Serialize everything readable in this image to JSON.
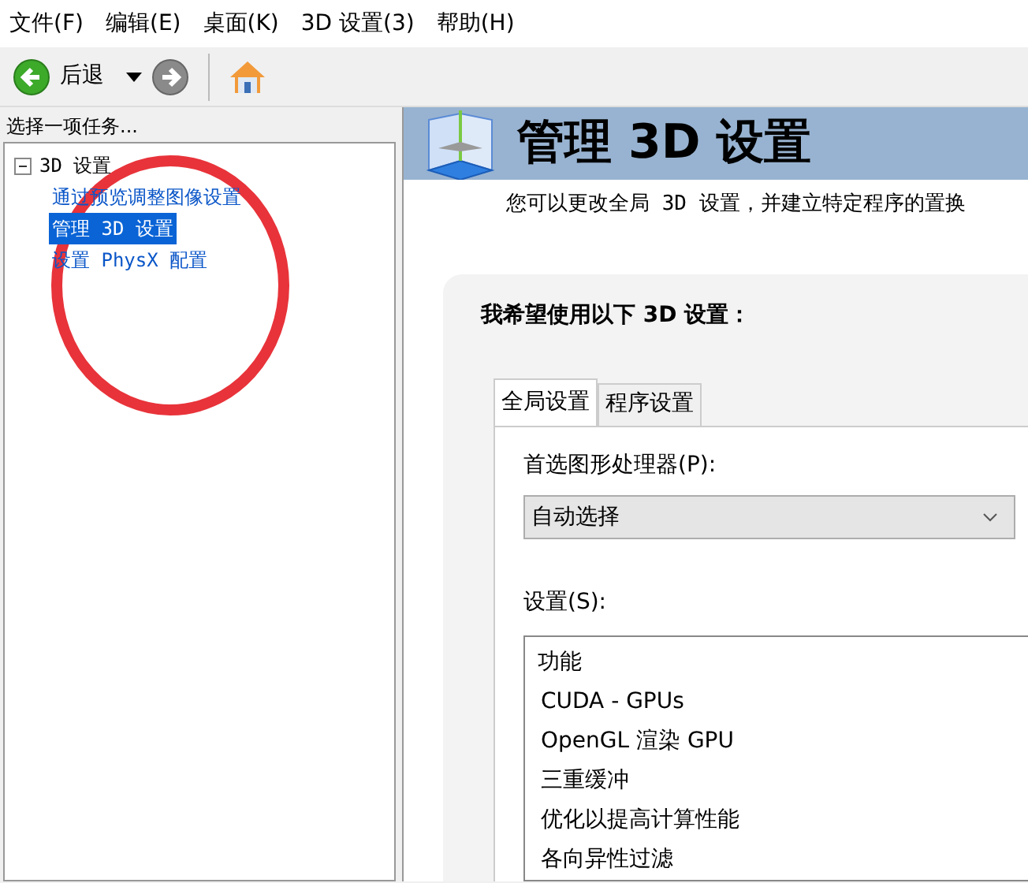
{
  "menu": [
    "文件(F)",
    "编辑(E)",
    "桌面(K)",
    "3D 设置(3)",
    "帮助(H)"
  ],
  "toolbar": {
    "back_label": "后退"
  },
  "sidebar": {
    "caption": "选择一项任务...",
    "tree": [
      {
        "label": "3D 设置",
        "expanded": true,
        "selected": false,
        "children": [
          {
            "label": "通过预览调整图像设置",
            "selected": false
          },
          {
            "label": "管理 3D 设置",
            "selected": true
          },
          {
            "label": "设置 PhysX 配置",
            "selected": false
          }
        ]
      }
    ]
  },
  "header": {
    "title": "管理 3D 设置"
  },
  "description": "您可以更改全局 3D 设置，并建立特定程序的置换",
  "panel": {
    "heading": "我希望使用以下 3D 设置：",
    "tabs": [
      {
        "label": "全局设置",
        "selected": true
      },
      {
        "label": "程序设置",
        "selected": false
      }
    ],
    "gpu_label": "首选图形处理器(P):",
    "gpu_value": "自动选择",
    "settings_label": "设置(S):",
    "settings": [
      {
        "label": "功能",
        "kind": "header"
      },
      {
        "label": "CUDA - GPUs",
        "kind": "row"
      },
      {
        "label": "OpenGL 渲染 GPU",
        "kind": "row"
      },
      {
        "label": "三重缓冲",
        "kind": "row"
      },
      {
        "label": "优化以提高计算性能",
        "kind": "row"
      },
      {
        "label": "各向异性过滤",
        "kind": "row"
      }
    ]
  },
  "annotation": {
    "color": "#e8333a"
  }
}
